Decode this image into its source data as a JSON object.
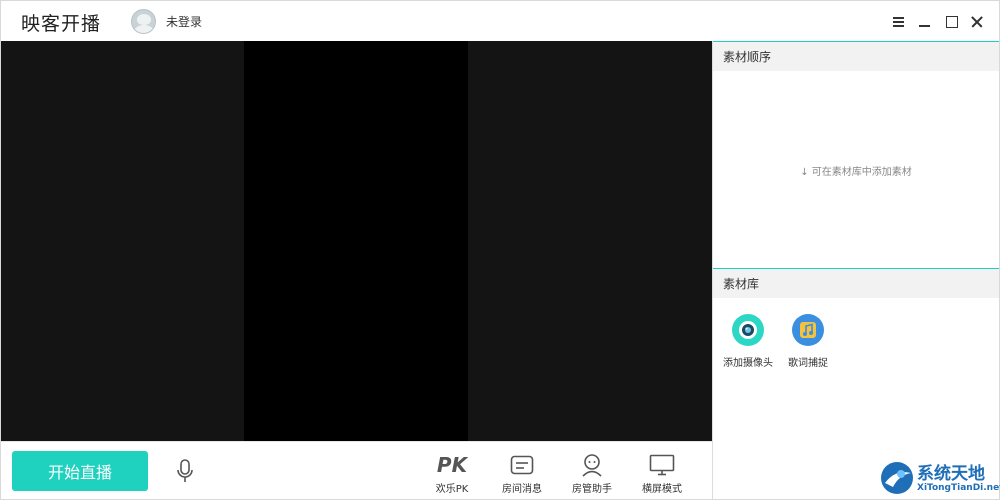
{
  "app": {
    "title": "映客开播"
  },
  "user": {
    "status": "未登录"
  },
  "window_controls": [
    "menu-icon",
    "minimize-icon",
    "maximize-icon",
    "close-icon"
  ],
  "bottombar": {
    "start_label": "开始直播",
    "tools": [
      {
        "label": "欢乐PK",
        "icon": "pk-icon",
        "icon_text": "PK"
      },
      {
        "label": "房间消息",
        "icon": "message-icon"
      },
      {
        "label": "房管助手",
        "icon": "assistant-icon"
      },
      {
        "label": "横屏模式",
        "icon": "monitor-icon"
      }
    ]
  },
  "material_order": {
    "title": "素材顺序",
    "hint": "可在素材库中添加素材"
  },
  "material_library": {
    "title": "素材库",
    "items": [
      {
        "label": "添加摄像头",
        "icon": "camera-icon"
      },
      {
        "label": "歌词捕捉",
        "icon": "lyrics-icon"
      }
    ]
  },
  "watermark": {
    "name": "系统天地",
    "url": "XiTongTianDi.net"
  },
  "colors": {
    "accent": "#1fd1bf",
    "preview_bg": "#141414",
    "preview_center": "#000000"
  }
}
